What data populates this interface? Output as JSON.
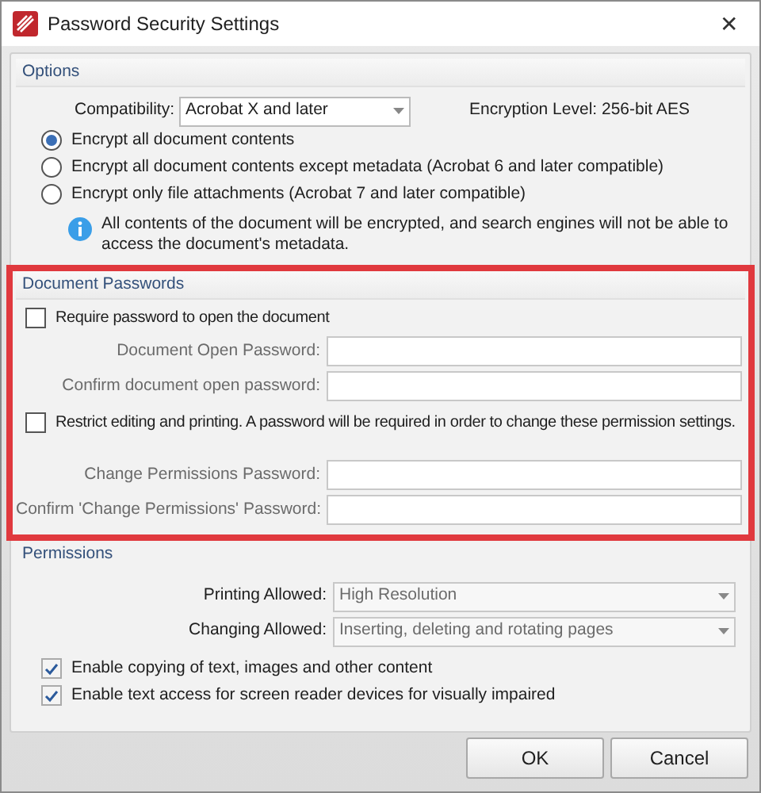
{
  "window": {
    "title": "Password Security Settings",
    "close": "✕"
  },
  "options": {
    "title": "Options",
    "compatibility": {
      "label": "Compatibility:",
      "value": "Acrobat X and later"
    },
    "encryption_level": "Encryption Level:  256-bit AES",
    "radios": [
      {
        "label": "Encrypt all document contents",
        "selected": true
      },
      {
        "label": "Encrypt all document contents except metadata (Acrobat 6 and later compatible)",
        "selected": false
      },
      {
        "label": "Encrypt only file attachments (Acrobat 7 and later compatible)",
        "selected": false
      }
    ],
    "info": "All contents of the document will be encrypted, and search engines will not be able to access the document's metadata."
  },
  "document_passwords": {
    "title": "Document Passwords",
    "highlighted": true,
    "items": [
      {
        "kind": "checkbox",
        "label": "Require password to open the document",
        "checked": false
      },
      {
        "kind": "field",
        "label": "Document Open Password:"
      },
      {
        "kind": "field",
        "label": "Confirm document open password:"
      },
      {
        "kind": "checkbox",
        "label": "Restrict editing and printing. A password will be required in order to change these permission settings.",
        "checked": false
      },
      {
        "kind": "spacer"
      },
      {
        "kind": "field",
        "label": "Change Permissions Password:"
      },
      {
        "kind": "field",
        "label": "Confirm 'Change Permissions' Password:"
      }
    ]
  },
  "permissions": {
    "title": "Permissions",
    "disabled": true,
    "dropdowns": [
      {
        "label": "Printing Allowed:",
        "value": "High Resolution"
      },
      {
        "label": "Changing Allowed:",
        "value": "Inserting, deleting and rotating pages"
      }
    ],
    "checkboxes": [
      {
        "label": "Enable copying of text, images and other content",
        "checked": true
      },
      {
        "label": "Enable text access for screen reader devices for visually impaired",
        "checked": true
      }
    ]
  },
  "buttons": [
    "OK",
    "Cancel"
  ]
}
